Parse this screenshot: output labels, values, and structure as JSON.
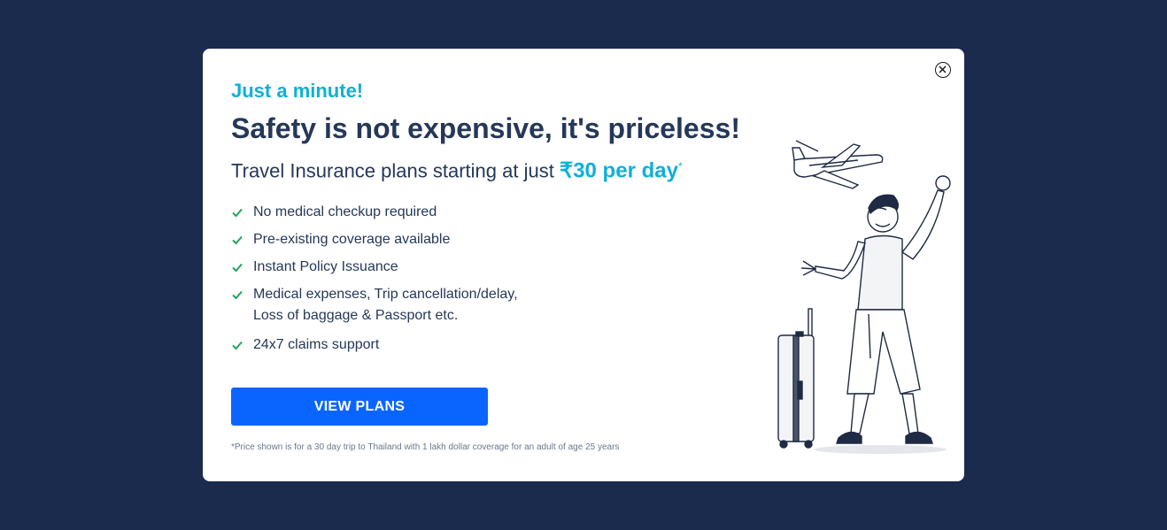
{
  "modal": {
    "eyebrow": "Just a minute!",
    "headline": "Safety is not expensive, it's priceless!",
    "subline_prefix": "Travel Insurance plans starting at just ",
    "price_text": "₹30 per day",
    "price_marker": "*",
    "features": [
      "No medical checkup required",
      "Pre-existing coverage available",
      "Instant Policy Issuance",
      "Medical expenses, Trip cancellation/delay,\nLoss of baggage & Passport etc.",
      "24x7 claims support"
    ],
    "cta_label": "VIEW PLANS",
    "footnote": "*Price shown is for a 30 day trip to Thailand with 1 lakh dollar coverage for an adult of age 25 years",
    "close_icon": "close-icon",
    "illustration": "traveler-with-suitcase-and-airplane"
  },
  "colors": {
    "background": "#1b2b4d",
    "accent": "#0fb0d6",
    "heading": "#253858",
    "button": "#0a65ff",
    "check": "#22a45d"
  }
}
